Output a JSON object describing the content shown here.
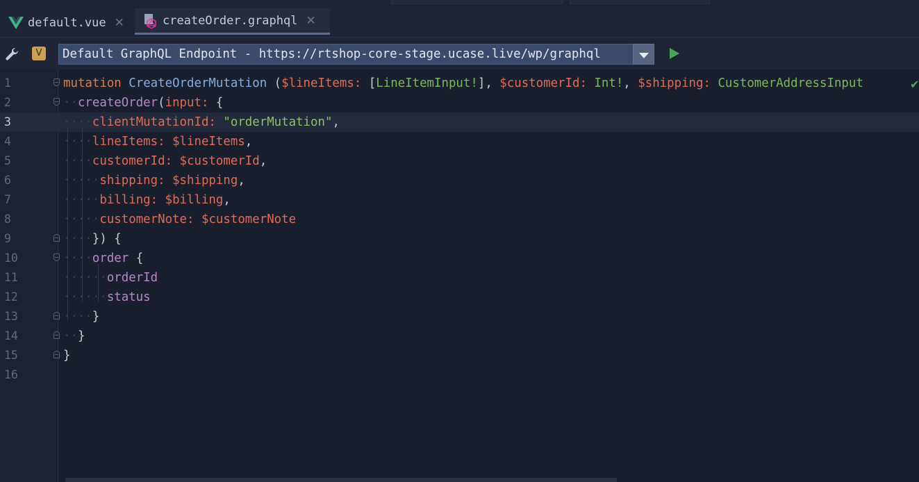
{
  "tabs": [
    {
      "label": "default.vue",
      "icon": "vue-logo-icon",
      "active": false
    },
    {
      "label": "createOrder.graphql",
      "icon": "graphql-file-icon",
      "active": true
    }
  ],
  "toolbar": {
    "badge_label": "V",
    "endpoint_label": "Default GraphQL Endpoint - https://rtshop-core-stage.ucase.live/wp/graphql"
  },
  "editor": {
    "current_line": 3,
    "line_numbers": [
      "1",
      "2",
      "3",
      "4",
      "5",
      "6",
      "7",
      "8",
      "9",
      "10",
      "11",
      "12",
      "13",
      "14",
      "15",
      "16"
    ],
    "lines": [
      {
        "dots": "",
        "tokens": [
          [
            "k",
            "mutation"
          ],
          [
            "p",
            " "
          ],
          [
            "fn",
            "CreateOrderMutation"
          ],
          [
            "p",
            " ("
          ],
          [
            "v",
            "$lineItems:"
          ],
          [
            "p",
            " ["
          ],
          [
            "t",
            "LineItemInput!"
          ],
          [
            "p",
            "], "
          ],
          [
            "v",
            "$customerId:"
          ],
          [
            "p",
            " "
          ],
          [
            "t",
            "Int!"
          ],
          [
            "p",
            ", "
          ],
          [
            "v",
            "$shipping:"
          ],
          [
            "p",
            " "
          ],
          [
            "t",
            "CustomerAddressInput"
          ]
        ]
      },
      {
        "dots": "··",
        "tokens": [
          [
            "f",
            "createOrder"
          ],
          [
            "p",
            "("
          ],
          [
            "v",
            "input:"
          ],
          [
            "p",
            " {"
          ]
        ]
      },
      {
        "dots": "····",
        "tokens": [
          [
            "v",
            "clientMutationId:"
          ],
          [
            "p",
            " "
          ],
          [
            "s",
            "\"orderMutation\""
          ],
          [
            "p",
            ","
          ]
        ]
      },
      {
        "dots": "····",
        "tokens": [
          [
            "v",
            "lineItems:"
          ],
          [
            "p",
            " "
          ],
          [
            "v",
            "$lineItems"
          ],
          [
            "p",
            ","
          ]
        ]
      },
      {
        "dots": "····",
        "tokens": [
          [
            "v",
            "customerId:"
          ],
          [
            "p",
            " "
          ],
          [
            "v",
            "$customerId"
          ],
          [
            "p",
            ","
          ]
        ]
      },
      {
        "dots": "·····",
        "tokens": [
          [
            "v",
            "shipping:"
          ],
          [
            "p",
            " "
          ],
          [
            "v",
            "$shipping"
          ],
          [
            "p",
            ","
          ]
        ]
      },
      {
        "dots": "·····",
        "tokens": [
          [
            "v",
            "billing:"
          ],
          [
            "p",
            " "
          ],
          [
            "v",
            "$billing"
          ],
          [
            "p",
            ","
          ]
        ]
      },
      {
        "dots": "·····",
        "tokens": [
          [
            "v",
            "customerNote:"
          ],
          [
            "p",
            " "
          ],
          [
            "v",
            "$customerNote"
          ]
        ]
      },
      {
        "dots": "····",
        "tokens": [
          [
            "p",
            "}) {"
          ]
        ]
      },
      {
        "dots": "····",
        "tokens": [
          [
            "f",
            "order"
          ],
          [
            "p",
            " {"
          ]
        ]
      },
      {
        "dots": "······",
        "tokens": [
          [
            "f",
            "orderId"
          ]
        ]
      },
      {
        "dots": "······",
        "tokens": [
          [
            "f",
            "status"
          ]
        ]
      },
      {
        "dots": "····",
        "tokens": [
          [
            "p",
            "}"
          ]
        ]
      },
      {
        "dots": "··",
        "tokens": [
          [
            "p",
            "}"
          ]
        ]
      },
      {
        "dots": "",
        "tokens": [
          [
            "p",
            "}"
          ]
        ]
      },
      {
        "dots": "",
        "tokens": []
      }
    ],
    "folds": {
      "1": "down",
      "2": "down",
      "9": "up",
      "10": "down",
      "13": "up",
      "14": "up",
      "15": "up"
    }
  },
  "status": {
    "inspection_icon": "check-icon"
  }
}
